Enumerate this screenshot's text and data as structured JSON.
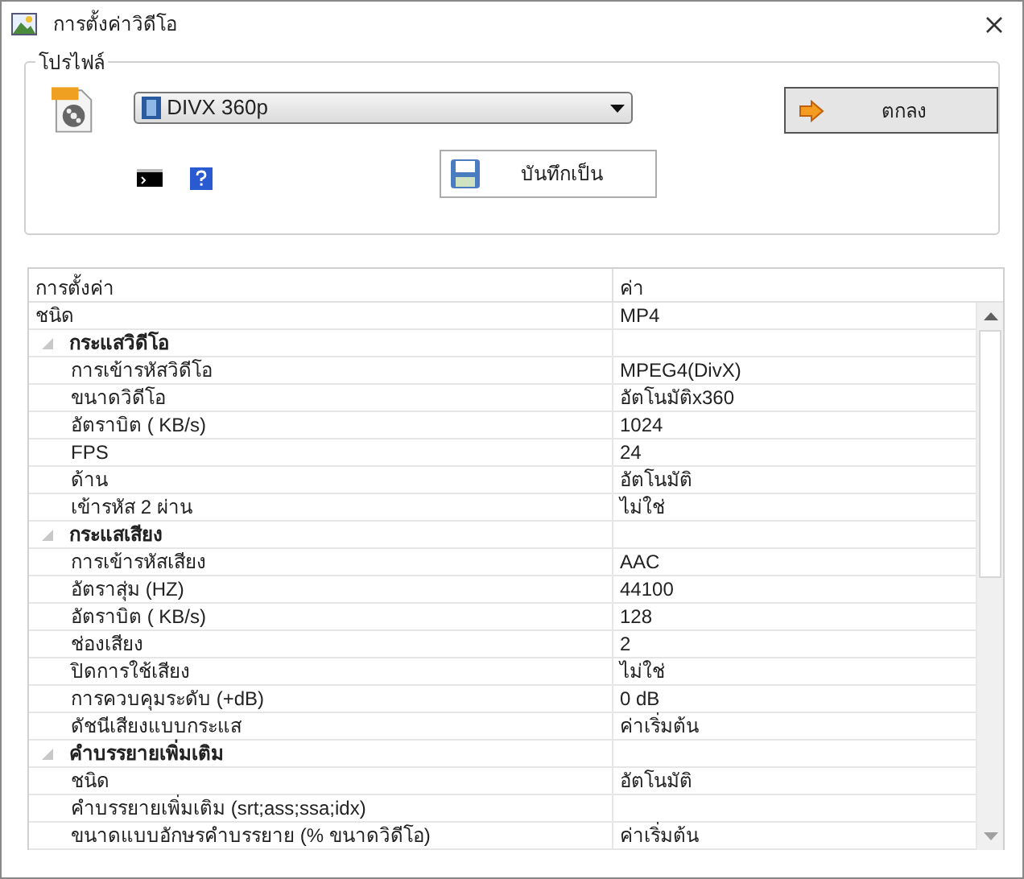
{
  "window": {
    "title": "การตั้งค่าวิดีโอ"
  },
  "profile": {
    "legend": "โปรไฟล์",
    "selected_profile": "DIVX 360p",
    "ok_button": "ตกลง",
    "save_button": "บันทึกเป็น"
  },
  "table": {
    "columns": [
      "การตั้งค่า",
      "ค่า"
    ],
    "rows": [
      {
        "kind": "property",
        "name": "ชนิด",
        "value": "MP4"
      },
      {
        "kind": "group",
        "name": "กระแสวิดีโอ",
        "expanded": true,
        "children": [
          {
            "kind": "property",
            "name": "การเข้ารหัสวิดีโอ",
            "value": "MPEG4(DivX)"
          },
          {
            "kind": "property",
            "name": "ขนาดวิดีโอ",
            "value": "อัตโนมัติx360"
          },
          {
            "kind": "property",
            "name": "อัตราบิต ( KB/s)",
            "value": "1024"
          },
          {
            "kind": "property",
            "name": "FPS",
            "value": "24"
          },
          {
            "kind": "property",
            "name": "ด้าน",
            "value": "อัตโนมัติ"
          },
          {
            "kind": "property",
            "name": "เข้ารหัส 2 ผ่าน",
            "value": "ไม่ใช่"
          }
        ]
      },
      {
        "kind": "group",
        "name": "กระแสเสียง",
        "expanded": true,
        "children": [
          {
            "kind": "property",
            "name": "การเข้ารหัสเสียง",
            "value": "AAC"
          },
          {
            "kind": "property",
            "name": "อัตราสุ่ม (HZ)",
            "value": "44100"
          },
          {
            "kind": "property",
            "name": "อัตราบิต ( KB/s)",
            "value": "128"
          },
          {
            "kind": "property",
            "name": "ช่องเสียง",
            "value": "2"
          },
          {
            "kind": "property",
            "name": "ปิดการใช้เสียง",
            "value": "ไม่ใช่"
          },
          {
            "kind": "property",
            "name": "การควบคุมระดับ (+dB)",
            "value": "0 dB"
          },
          {
            "kind": "property",
            "name": "ดัชนีเสียงแบบกระแส",
            "value": "ค่าเริ่มต้น"
          }
        ]
      },
      {
        "kind": "group",
        "name": "คำบรรยายเพิ่มเติม",
        "expanded": true,
        "children": [
          {
            "kind": "property",
            "name": "ชนิด",
            "value": "อัตโนมัติ"
          },
          {
            "kind": "property",
            "name": "คำบรรยายเพิ่มเติม (srt;ass;ssa;idx)"
          },
          {
            "kind": "property",
            "name": "ขนาดแบบอักษรคำบรรยาย (% ขนาดวิดีโอ)",
            "value": "ค่าเริ่มต้น"
          }
        ]
      }
    ]
  }
}
